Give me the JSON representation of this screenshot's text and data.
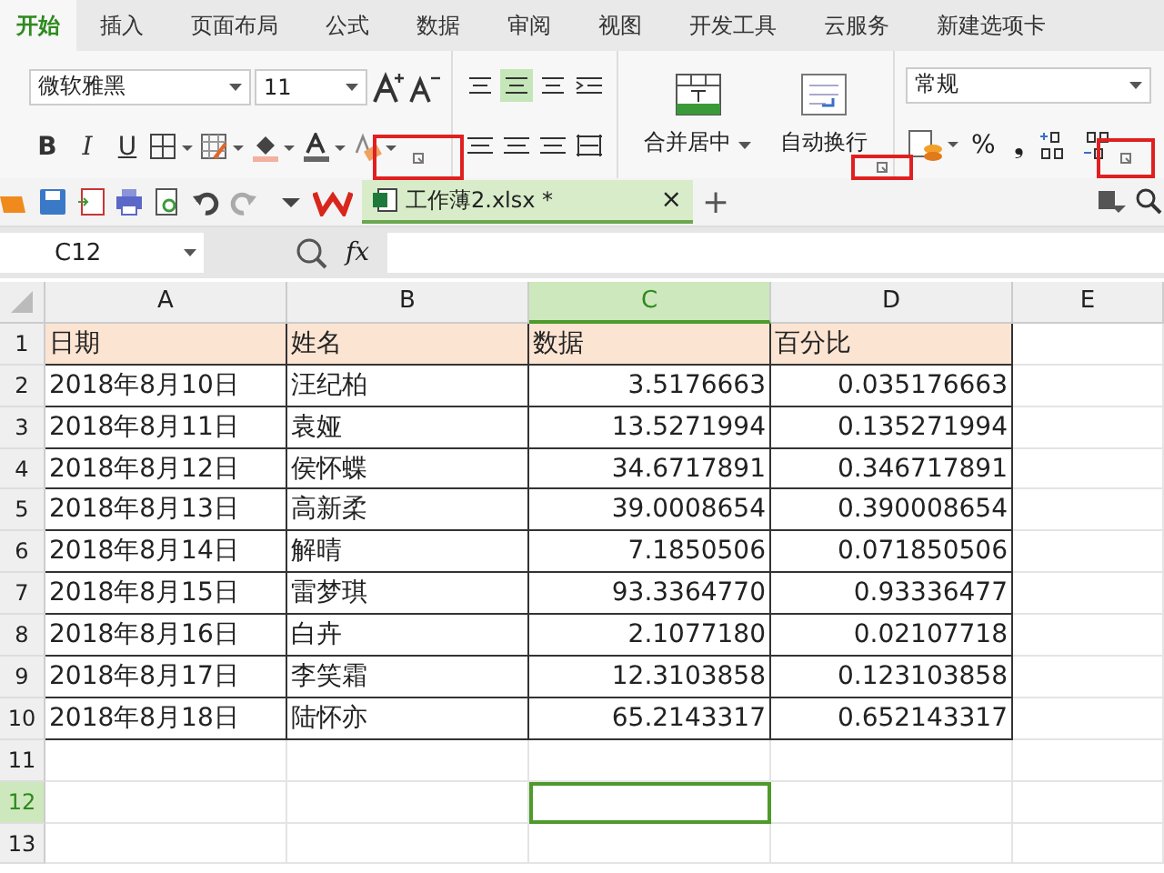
{
  "tabs": [
    {
      "label": "开始",
      "selected": true
    },
    {
      "label": "插入",
      "selected": false
    },
    {
      "label": "页面布局",
      "selected": false
    },
    {
      "label": "公式",
      "selected": false
    },
    {
      "label": "数据",
      "selected": false
    },
    {
      "label": "审阅",
      "selected": false
    },
    {
      "label": "视图",
      "selected": false
    },
    {
      "label": "开发工具",
      "selected": false
    },
    {
      "label": "云服务",
      "selected": false
    },
    {
      "label": "新建选项卡",
      "selected": false
    }
  ],
  "ribbon": {
    "font": "微软雅黑",
    "size": "11",
    "bold": "B",
    "italic": "I",
    "underline": "U",
    "merge_label": "合并居中",
    "wrap_label": "自动换行",
    "number_format": "常规",
    "percent": "%",
    "comma": "❟"
  },
  "file_bar": {
    "file_tab": "工作薄2.xlsx *",
    "close": "×",
    "add": "+"
  },
  "formula_bar": {
    "name_box": "C12",
    "fx": "fx"
  },
  "sheet": {
    "columns": [
      {
        "label": "A",
        "kind": "text",
        "selected": false
      },
      {
        "label": "B",
        "kind": "text",
        "selected": false
      },
      {
        "label": "C",
        "kind": "number",
        "selected": true
      },
      {
        "label": "D",
        "kind": "number",
        "selected": false
      },
      {
        "label": "E",
        "kind": "text",
        "selected": false
      }
    ],
    "rows": [
      {
        "label": "1",
        "kind": "header",
        "selected": false,
        "cells": [
          "日期",
          "姓名",
          "数据",
          "百分比"
        ]
      },
      {
        "label": "2",
        "kind": "data",
        "selected": false,
        "cells": [
          "2018年8月10日",
          "汪纪柏",
          "3.5176663",
          "0.035176663"
        ]
      },
      {
        "label": "3",
        "kind": "data",
        "selected": false,
        "cells": [
          "2018年8月11日",
          "袁娅",
          "13.5271994",
          "0.135271994"
        ]
      },
      {
        "label": "4",
        "kind": "data",
        "selected": false,
        "cells": [
          "2018年8月12日",
          "侯怀蝶",
          "34.6717891",
          "0.346717891"
        ]
      },
      {
        "label": "5",
        "kind": "data",
        "selected": false,
        "cells": [
          "2018年8月13日",
          "高新柔",
          "39.0008654",
          "0.390008654"
        ]
      },
      {
        "label": "6",
        "kind": "data",
        "selected": false,
        "cells": [
          "2018年8月14日",
          "解晴",
          "7.1850506",
          "0.071850506"
        ]
      },
      {
        "label": "7",
        "kind": "data",
        "selected": false,
        "cells": [
          "2018年8月15日",
          "雷梦琪",
          "93.3364770",
          "0.93336477"
        ]
      },
      {
        "label": "8",
        "kind": "data",
        "selected": false,
        "cells": [
          "2018年8月16日",
          "白卉",
          "2.1077180",
          "0.02107718"
        ]
      },
      {
        "label": "9",
        "kind": "data",
        "selected": false,
        "cells": [
          "2018年8月17日",
          "李笑霜",
          "12.3103858",
          "0.123103858"
        ]
      },
      {
        "label": "10",
        "kind": "data",
        "selected": false,
        "cells": [
          "2018年8月18日",
          "陆怀亦",
          "65.2143317",
          "0.652143317"
        ]
      },
      {
        "label": "11",
        "kind": "empty",
        "selected": false,
        "cells": []
      },
      {
        "label": "12",
        "kind": "empty",
        "selected": true,
        "cells": []
      },
      {
        "label": "13",
        "kind": "empty",
        "selected": false,
        "cells": []
      }
    ]
  },
  "red_frames": [
    {
      "kind": "frame"
    },
    {
      "kind": "frame"
    },
    {
      "kind": "frame"
    }
  ]
}
